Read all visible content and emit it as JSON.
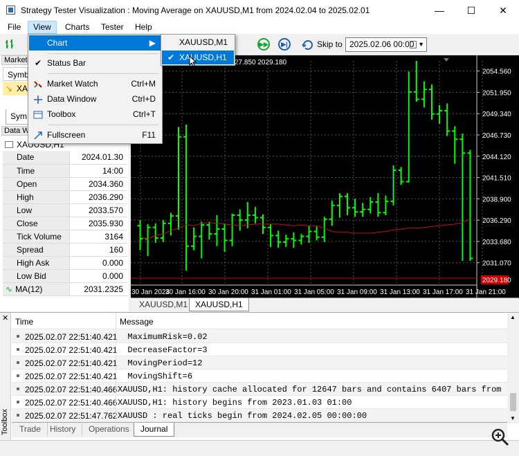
{
  "window": {
    "title": "Strategy Tester Visualization : Moving Average on XAUUSD,M1 from 2024.02.04 to 2025.02.01",
    "minimize": "—",
    "maximize": "☐",
    "close": "✕"
  },
  "menu": {
    "items": [
      "File",
      "View",
      "Charts",
      "Tester",
      "Help"
    ]
  },
  "toolbar": {
    "skip_label": "Skip to",
    "skip_date": "2025.02.06 00:00"
  },
  "view_menu": {
    "chart": "Chart",
    "status_bar": "Status Bar",
    "market_watch": "Market Watch",
    "market_watch_sc": "Ctrl+M",
    "data_window": "Data Window",
    "data_window_sc": "Ctrl+D",
    "toolbox": "Toolbox",
    "toolbox_sc": "Ctrl+T",
    "fullscreen": "Fullscreen",
    "fullscreen_sc": "F11"
  },
  "chart_submenu": {
    "m1": "XAUUSD,M1",
    "h1": "XAUUSD,H1"
  },
  "market_watch": {
    "header": "Market W",
    "col": "Symb",
    "symbol": "XA",
    "tab": "Sym"
  },
  "data_window": {
    "header": "Data W",
    "symbol": "XAUUSD,H1",
    "rows": [
      {
        "k": "Date",
        "v": "2024.01.30"
      },
      {
        "k": "Time",
        "v": "14:00"
      },
      {
        "k": "Open",
        "v": "2034.360"
      },
      {
        "k": "High",
        "v": "2036.290"
      },
      {
        "k": "Low",
        "v": "2033.570"
      },
      {
        "k": "Close",
        "v": "2035.930"
      },
      {
        "k": "Tick Volume",
        "v": "3164"
      },
      {
        "k": "Spread",
        "v": "160"
      },
      {
        "k": "High Ask",
        "v": "0.000"
      },
      {
        "k": "Low Bid",
        "v": "0.000"
      },
      {
        "k": "MA(12)",
        "v": "2031.2325"
      }
    ]
  },
  "chart_tabs": [
    "XAUUSD,M1",
    "XAUUSD,H1"
  ],
  "journal": {
    "col_time": "Time",
    "col_message": "Message",
    "rows": [
      {
        "t": "2025.02.07 22:51:40.421",
        "m": "  MaximumRisk=0.02"
      },
      {
        "t": "2025.02.07 22:51:40.421",
        "m": "  DecreaseFactor=3"
      },
      {
        "t": "2025.02.07 22:51:40.421",
        "m": "  MovingPeriod=12"
      },
      {
        "t": "2025.02.07 22:51:40.421",
        "m": "  MovingShift=6"
      },
      {
        "t": "2025.02.07 22:51:40.466",
        "m": "XAUUSD,H1: history cache allocated for 12647 bars and contains 6407 bars from 202..."
      },
      {
        "t": "2025.02.07 22:51:40.466",
        "m": "XAUUSD,H1: history begins from 2023.01.03 01:00"
      },
      {
        "t": "2025.02.07 22:51:47.762",
        "m": "XAUUSD : real ticks begin from 2024.02.05 00:00:00"
      }
    ]
  },
  "bottom_tabs": [
    "Trade",
    "History",
    "Operations",
    "Journal"
  ],
  "toolbox_label": "Toolbox",
  "chart_data": {
    "type": "candlestick",
    "symbol": "XAUUSD,H1",
    "header_fragment": "27.850 2029.180",
    "y_ticks": [
      "2054.560",
      "2051.950",
      "2049.340",
      "2046.730",
      "2044.120",
      "2041.510",
      "2038.900",
      "2036.290",
      "2033.680",
      "2031.070"
    ],
    "x_ticks": [
      "30 Jan 2024",
      "30 Jan 16:00",
      "30 Jan 20:00",
      "31 Jan 01:00",
      "31 Jan 05:00",
      "31 Jan 09:00",
      "31 Jan 13:00",
      "31 Jan 17:00",
      "31 Jan 21:00"
    ],
    "price_tag": "2029.180",
    "bar_color": "#00ff00",
    "ma_color": "#c81010",
    "ylim": [
      2029.18,
      2055.8
    ],
    "bars": [
      [
        2035.6,
        2036.3,
        2032.6,
        2034.0
      ],
      [
        2034.0,
        2035.8,
        2031.9,
        2035.4
      ],
      [
        2035.4,
        2035.9,
        2033.5,
        2034.1
      ],
      [
        2034.1,
        2036.3,
        2033.6,
        2035.9
      ],
      [
        2035.9,
        2037.2,
        2034.4,
        2036.8
      ],
      [
        2036.8,
        2047.7,
        2035.1,
        2046.5
      ],
      [
        2046.5,
        2048.0,
        2030.1,
        2033.1
      ],
      [
        2033.1,
        2035.4,
        2032.6,
        2034.3
      ],
      [
        2034.3,
        2036.1,
        2031.6,
        2035.7
      ],
      [
        2035.7,
        2036.1,
        2033.9,
        2034.6
      ],
      [
        2034.6,
        2036.9,
        2033.1,
        2035.2
      ],
      [
        2035.2,
        2035.9,
        2032.4,
        2033.8
      ],
      [
        2033.8,
        2037.1,
        2033.1,
        2036.9
      ],
      [
        2036.9,
        2037.6,
        2035.0,
        2036.3
      ],
      [
        2036.3,
        2038.5,
        2035.3,
        2036.9
      ],
      [
        2036.9,
        2037.9,
        2035.9,
        2036.6
      ],
      [
        2036.6,
        2037.0,
        2034.6,
        2035.4
      ],
      [
        2035.4,
        2035.8,
        2033.0,
        2034.4
      ],
      [
        2034.4,
        2035.0,
        2032.9,
        2033.6
      ],
      [
        2033.6,
        2034.5,
        2033.0,
        2034.0
      ],
      [
        2034.0,
        2034.8,
        2032.9,
        2033.8
      ],
      [
        2033.8,
        2034.6,
        2033.3,
        2034.3
      ],
      [
        2034.3,
        2035.6,
        2033.5,
        2034.9
      ],
      [
        2034.9,
        2035.5,
        2033.8,
        2034.2
      ],
      [
        2034.2,
        2036.7,
        2033.6,
        2036.4
      ],
      [
        2036.4,
        2038.7,
        2035.6,
        2038.1
      ],
      [
        2038.1,
        2039.6,
        2036.6,
        2039.2
      ],
      [
        2039.2,
        2039.6,
        2036.9,
        2037.8
      ],
      [
        2037.8,
        2038.9,
        2036.7,
        2037.3
      ],
      [
        2037.3,
        2038.4,
        2036.7,
        2037.6
      ],
      [
        2037.6,
        2039.1,
        2037.1,
        2038.5
      ],
      [
        2038.5,
        2039.6,
        2036.7,
        2037.2
      ],
      [
        2037.2,
        2039.3,
        2036.9,
        2038.6
      ],
      [
        2038.6,
        2043.0,
        2038.1,
        2042.4
      ],
      [
        2042.4,
        2042.8,
        2040.6,
        2041.0
      ],
      [
        2041.0,
        2054.5,
        2040.9,
        2052.0
      ],
      [
        2052.0,
        2055.8,
        2050.8,
        2051.1
      ],
      [
        2051.1,
        2053.3,
        2050.1,
        2052.3
      ],
      [
        2052.3,
        2052.9,
        2048.6,
        2049.3
      ],
      [
        2049.3,
        2050.4,
        2048.1,
        2049.7
      ],
      [
        2049.7,
        2050.6,
        2046.6,
        2047.2
      ],
      [
        2047.2,
        2047.8,
        2043.2,
        2046.2
      ],
      [
        2046.2,
        2046.9,
        2031.3,
        2044.5
      ],
      [
        2044.5,
        2044.9,
        2031.3,
        2031.6
      ]
    ],
    "ma": [
      2034.2,
      2034.0,
      2034.4,
      2034.6,
      2035.0,
      2035.3,
      2035.7,
      2035.6,
      2035.9,
      2036.0,
      2035.9,
      2035.8,
      2035.7,
      2035.6,
      2035.7,
      2035.8,
      2035.8,
      2035.8,
      2035.8,
      2035.7,
      2035.6,
      2035.7,
      2035.6,
      2035.6,
      2035.3,
      2034.9,
      2034.8,
      2034.8,
      2034.7,
      2034.7,
      2034.7,
      2034.8,
      2034.9,
      2035.1,
      2035.2,
      2035.3,
      2035.3,
      2035.4,
      2035.5,
      2035.6,
      2035.7,
      2035.8,
      2036.0,
      2036.4
    ]
  }
}
